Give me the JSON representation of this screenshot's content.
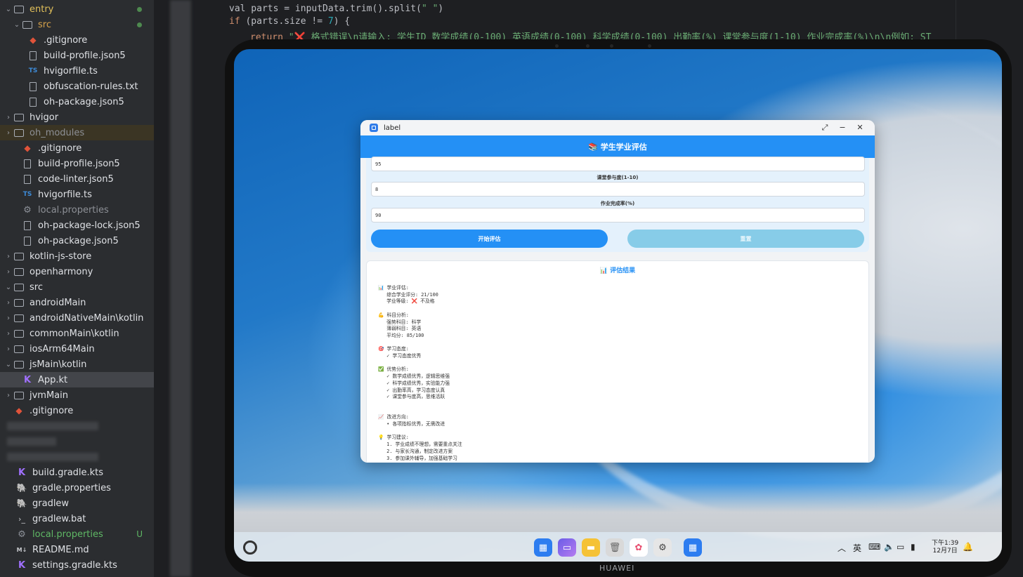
{
  "ide": {
    "tree": [
      {
        "label": "entry",
        "type": "folder",
        "open": true,
        "cls": "yellow",
        "indent": 0
      },
      {
        "label": "src",
        "type": "folder",
        "open": true,
        "cls": "orange",
        "indent": 1
      },
      {
        "label": ".gitignore",
        "type": "git",
        "indent": 2
      },
      {
        "label": "build-profile.json5",
        "type": "file",
        "indent": 2
      },
      {
        "label": "hvigorfile.ts",
        "type": "ts",
        "indent": 2
      },
      {
        "label": "obfuscation-rules.txt",
        "type": "file",
        "indent": 2
      },
      {
        "label": "oh-package.json5",
        "type": "file",
        "indent": 2
      },
      {
        "label": "hvigor",
        "type": "folder",
        "open": false,
        "indent": 0
      },
      {
        "label": "oh_modules",
        "type": "folder",
        "open": false,
        "cls": "dim",
        "indent": 0
      },
      {
        "label": ".gitignore",
        "type": "git",
        "indent": 1
      },
      {
        "label": "build-profile.json5",
        "type": "file",
        "indent": 1
      },
      {
        "label": "code-linter.json5",
        "type": "file",
        "indent": 1
      },
      {
        "label": "hvigorfile.ts",
        "type": "ts",
        "indent": 1
      },
      {
        "label": "local.properties",
        "type": "gear",
        "cls": "dim",
        "indent": 1
      },
      {
        "label": "oh-package-lock.json5",
        "type": "file",
        "indent": 1
      },
      {
        "label": "oh-package.json5",
        "type": "file",
        "indent": 1
      },
      {
        "label": "kotlin-js-store",
        "type": "folder",
        "open": false,
        "indent": -1
      },
      {
        "label": "openharmony",
        "type": "folder",
        "open": false,
        "indent": -1
      },
      {
        "label": "src",
        "type": "folder",
        "open": true,
        "indent": -1
      },
      {
        "label": "androidMain",
        "type": "folder",
        "open": false,
        "indent": 0
      },
      {
        "label": "androidNativeMain\\kotlin",
        "type": "folder",
        "open": false,
        "indent": 0
      },
      {
        "label": "commonMain\\kotlin",
        "type": "folder",
        "open": false,
        "indent": 0
      },
      {
        "label": "iosArm64Main",
        "type": "folder",
        "open": false,
        "indent": 0
      },
      {
        "label": "jsMain\\kotlin",
        "type": "folder",
        "open": true,
        "indent": 0
      },
      {
        "label": "App.kt",
        "type": "kt",
        "indent": 1
      },
      {
        "label": "jvmMain",
        "type": "folder",
        "open": false,
        "indent": 0
      },
      {
        "label": ".gitignore",
        "type": "git",
        "indent": -1
      },
      {
        "label": "",
        "type": "blur",
        "indent": -1
      },
      {
        "label": "",
        "type": "blur",
        "indent": -1
      },
      {
        "label": "",
        "type": "blur",
        "indent": -1
      },
      {
        "label": "build.gradle.kts",
        "type": "kt",
        "indent": -2
      },
      {
        "label": "gradle.properties",
        "type": "gradle",
        "indent": -2
      },
      {
        "label": "gradlew",
        "type": "gradle",
        "indent": -2
      },
      {
        "label": "gradlew.bat",
        "type": "term",
        "indent": -2
      },
      {
        "label": "local.properties",
        "type": "gear",
        "cls": "green",
        "status": "U",
        "indent": -2
      },
      {
        "label": "README.md",
        "type": "md",
        "indent": -2
      },
      {
        "label": "settings.gradle.kts",
        "type": "kt",
        "indent": -2
      }
    ],
    "code": {
      "line1_a": "val parts = inputData.trim().split(",
      "line1_b": "\" \"",
      "line1_c": ")",
      "line2_a": "if",
      "line2_b": " (parts.size != ",
      "line2_c": "7",
      "line2_d": ") {",
      "line3_a": "return",
      "line3_b": "\"❌ 格式错误\\n请输入: 学生ID 数学成绩(0-100) 英语成绩(0-100) 科学成绩(0-100) 出勤率(%) 课堂参与度(1-10) 作业完成率(%)\\n\\n例如: ST"
    }
  },
  "device": {
    "brand": "HUAWEI",
    "clock_time": "下午1:39",
    "clock_date": "12月7日"
  },
  "app": {
    "window_title": "label",
    "header_title": "📚 学生学业评估",
    "fields": [
      {
        "label": "",
        "value": "95"
      },
      {
        "label": "课堂参与度(1-10)",
        "value": "8"
      },
      {
        "label": "作业完成率(%)",
        "value": "90"
      }
    ],
    "start_button": "开始评估",
    "reset_button": "重置",
    "result_title": "📊 评估结果",
    "result_text": "📊 学业评估:\n   综合学业评分: 21/100\n   学业等级: ❌ 不及格\n\n💪 科目分析:\n   强势科目: 科学\n   薄弱科目: 英语\n   平均分: 85/100\n\n🎯 学习态度:\n   ✓ 学习态度优秀\n\n✅ 优势分析:\n   ✓ 数学成绩优秀，逻辑思维强\n   ✓ 科学成绩优秀，实验能力强\n   ✓ 出勤率高，学习态度认真\n   ✓ 课堂参与度高，思维活跃\n\n\n📈 改进方向:\n   • 各项指标优秀，无需改进\n\n💡 学习建议:\n   1. 学业成绩不理想，需要重点关注\n   2. 与家长沟通，制定改进方案\n   3. 参加课外辅导，加强基础学习"
  }
}
